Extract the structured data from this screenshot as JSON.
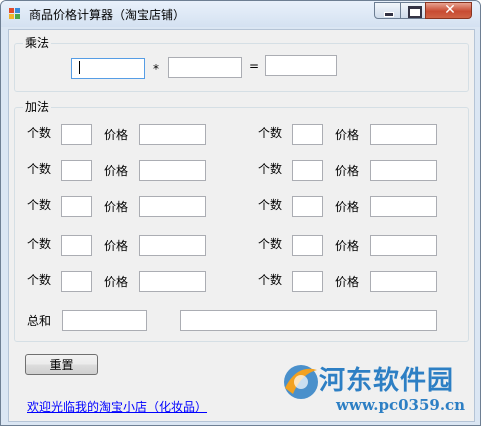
{
  "window": {
    "title": "商品价格计算器（淘宝店铺）",
    "close_glyph": "✕",
    "icon": "app-window-icon"
  },
  "multiply": {
    "group_label": "乘法",
    "operand1": "",
    "operator": "*",
    "operand2": "",
    "equals": "=",
    "result": ""
  },
  "addition": {
    "group_label": "加法",
    "count_label": "个数",
    "price_label": "价格",
    "rows": [
      {
        "left_count": "",
        "left_price": "",
        "right_count": "",
        "right_price": ""
      },
      {
        "left_count": "",
        "left_price": "",
        "right_count": "",
        "right_price": ""
      },
      {
        "left_count": "",
        "left_price": "",
        "right_count": "",
        "right_price": ""
      },
      {
        "left_count": "",
        "left_price": "",
        "right_count": "",
        "right_price": ""
      },
      {
        "left_count": "",
        "left_price": "",
        "right_count": "",
        "right_price": ""
      }
    ],
    "total_label": "总和",
    "total_value": "",
    "total_text": ""
  },
  "reset_label": "重置",
  "shop_link": "欢迎光临我的淘宝小店（化妆品）",
  "watermark": {
    "name": "河东软件园",
    "url": "www.pc0359.cn"
  },
  "colors": {
    "link": "#0000ff",
    "watermark": "#2d7fc4",
    "close_button": "#c84b32"
  }
}
